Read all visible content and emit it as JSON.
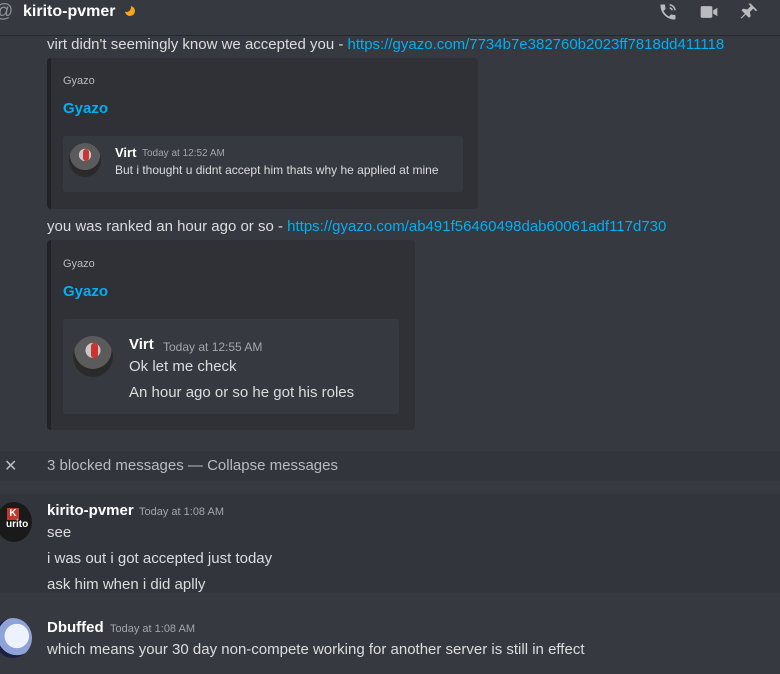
{
  "header": {
    "dm_name": "kirito-pvmer",
    "icons": [
      "at-icon",
      "moon-status-icon",
      "phone-call-icon",
      "video-call-icon",
      "pin-icon"
    ]
  },
  "messages": {
    "m1": {
      "text": "virt didn't seemingly know we accepted you - ",
      "link": "https://gyazo.com/7734b7e382760b2023ff7818dd411118",
      "embed": {
        "provider": "Gyazo",
        "title": "Gyazo",
        "quote": {
          "author": "Virt",
          "time": "Today at 12:52 AM",
          "lines": [
            "But i thought u didnt accept him thats why he applied at mine"
          ]
        }
      }
    },
    "m2": {
      "text": "you was ranked an hour ago or so - ",
      "link": "https://gyazo.com/ab491f56460498dab60061adf117d730",
      "embed": {
        "provider": "Gyazo",
        "title": "Gyazo",
        "quote": {
          "author": "Virt",
          "time": "Today at 12:55 AM",
          "lines": [
            "Ok let me check",
            "An hour ago or so he got his roles"
          ]
        }
      }
    }
  },
  "blocked": {
    "label": "3 blocked messages — ",
    "collapse_label": "Collapse messages"
  },
  "groups": {
    "kirito": {
      "author": "kirito-pvmer",
      "time": "Today at 1:08 AM",
      "avatar_text": "urito",
      "lines": [
        "see",
        "i was out i got accepted just today",
        "ask him when i did aplly"
      ]
    },
    "dbuffed": {
      "author": "Dbuffed",
      "time": "Today at 1:08 AM",
      "lines": [
        "which means your 30 day non-compete working for another server is still in effect"
      ]
    }
  },
  "colors": {
    "background": "#36393f",
    "link": "#00b0f4",
    "embed_background": "#2f3136",
    "status_idle": "#faa61a"
  }
}
